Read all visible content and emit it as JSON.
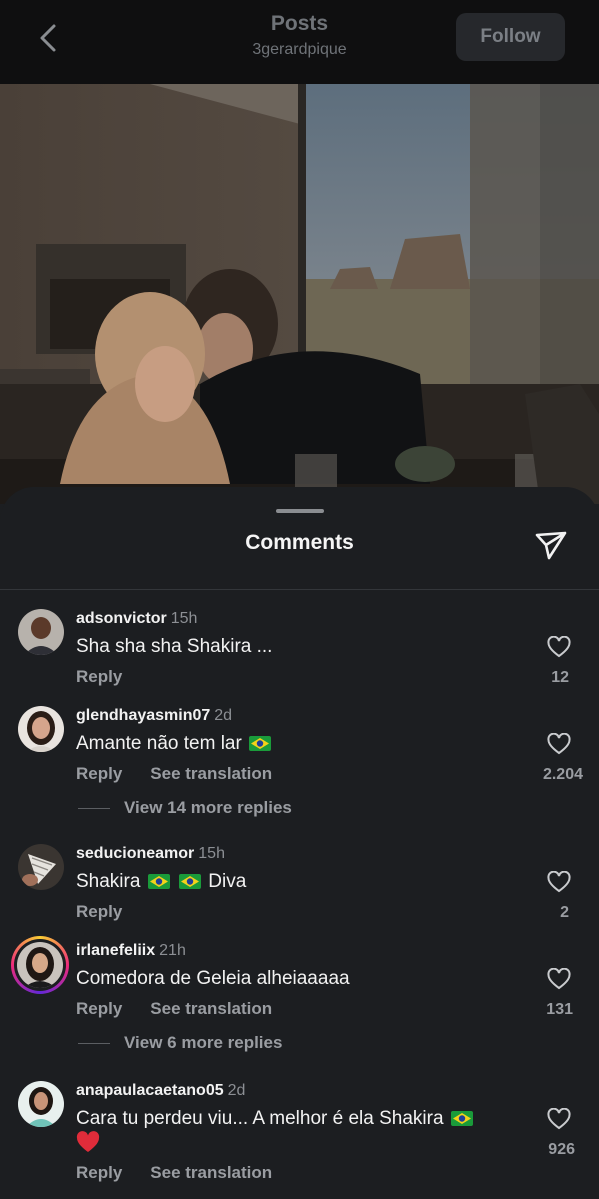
{
  "header": {
    "title": "Posts",
    "subtitle": "3gerardpique",
    "follow_label": "Follow"
  },
  "sheet": {
    "title": "Comments"
  },
  "comments": [
    {
      "username": "adsonvictor",
      "time": "15h",
      "text": "Sha sha sha Shakira ...",
      "reply": "Reply",
      "likes": "12"
    },
    {
      "username": "glendhayasmin07",
      "time": "2d",
      "text": "Amante não tem lar",
      "reply": "Reply",
      "translate": "See translation",
      "likes": "2.204",
      "more_replies": "View 14 more replies"
    },
    {
      "username": "seducioneamor",
      "time": "15h",
      "text_a": "Shakira",
      "text_b": "Diva",
      "reply": "Reply",
      "likes": "2"
    },
    {
      "username": "irlanefeliix",
      "time": "21h",
      "text": "Comedora de Geleia alheiaaaaa",
      "reply": "Reply",
      "translate": "See translation",
      "likes": "131",
      "more_replies": "View 6 more replies"
    },
    {
      "username": "anapaulacaetano05",
      "time": "2d",
      "text": "Cara tu perdeu viu... A melhor é ela Shakira",
      "reply": "Reply",
      "translate": "See translation",
      "likes": "926"
    }
  ],
  "icons": {
    "back": "chevron-left-icon",
    "send": "paper-plane-icon",
    "like": "heart-outline-icon",
    "flag": "brazil-flag-icon",
    "red_heart": "red-heart-icon"
  },
  "colors": {
    "background": "#1c1e21",
    "topbar": "#0f0f10",
    "muted_text": "#9a9da2"
  }
}
